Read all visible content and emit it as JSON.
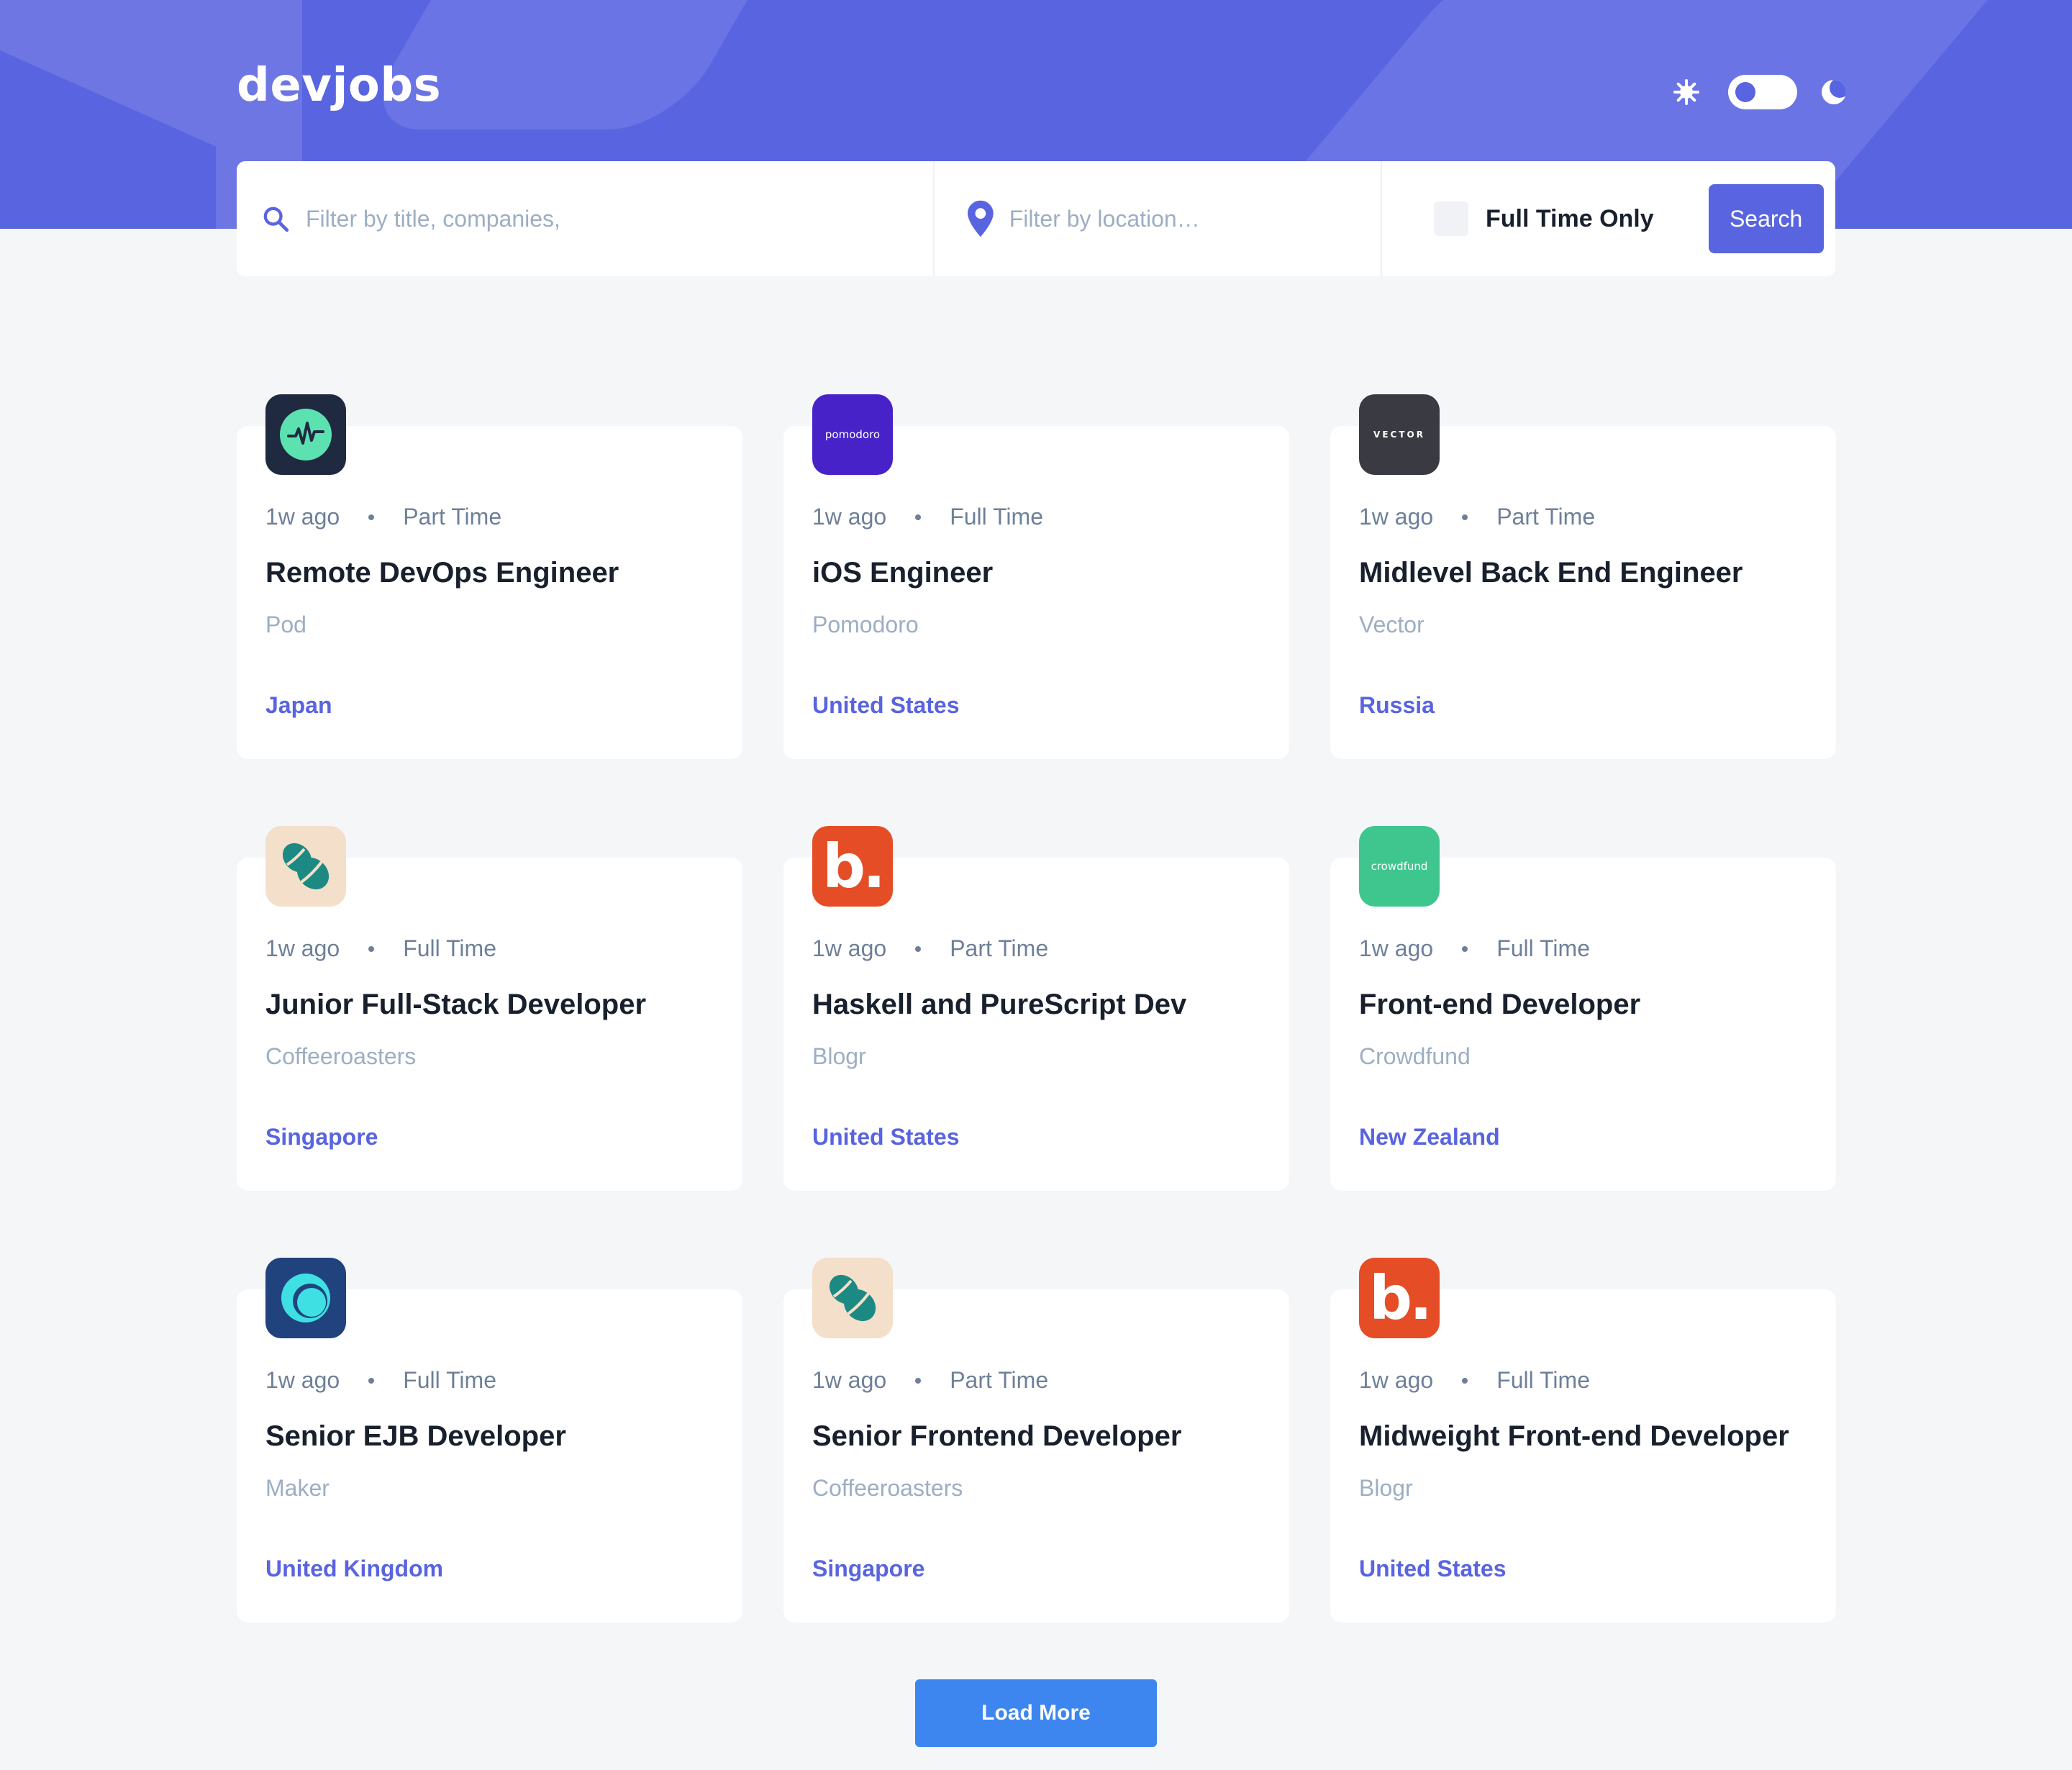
{
  "brand": "devjobs",
  "colors": {
    "accent": "#5964E0",
    "header_bg": "#5964E0",
    "page_bg": "#F4F6F8",
    "load_more": "#3D86F0"
  },
  "theme_toggle": {
    "light_icon": "sun-icon",
    "dark_icon": "moon-icon",
    "mode": "light"
  },
  "search": {
    "title_placeholder": "Filter by title, companies,",
    "title_value": "",
    "location_placeholder": "Filter by location…",
    "location_value": "",
    "full_time_label": "Full Time Only",
    "full_time_checked": false,
    "button_label": "Search"
  },
  "jobs": [
    {
      "posted": "1w ago",
      "contract": "Part Time",
      "title": "Remote DevOps Engineer",
      "company": "Pod",
      "location": "Japan",
      "logo_bg": "#1F2A40",
      "logo_icon": "pod-wave-icon"
    },
    {
      "posted": "1w ago",
      "contract": "Full Time",
      "title": "iOS Engineer",
      "company": "Pomodoro",
      "location": "United States",
      "logo_bg": "#4722C8",
      "logo_text": "pomodoro"
    },
    {
      "posted": "1w ago",
      "contract": "Part Time",
      "title": "Midlevel Back End Engineer",
      "company": "Vector",
      "location": "Russia",
      "logo_bg": "#3A3A42",
      "logo_text": "VECTOR"
    },
    {
      "posted": "1w ago",
      "contract": "Full Time",
      "title": "Junior Full-Stack Developer",
      "company": "Coffeeroasters",
      "location": "Singapore",
      "logo_bg": "#F4DFCB",
      "logo_icon": "coffee-beans-icon"
    },
    {
      "posted": "1w ago",
      "contract": "Part Time",
      "title": "Haskell and PureScript Dev",
      "company": "Blogr",
      "location": "United States",
      "logo_bg": "#E54D26",
      "logo_text": "b."
    },
    {
      "posted": "1w ago",
      "contract": "Full Time",
      "title": "Front-end Developer",
      "company": "Crowdfund",
      "location": "New Zealand",
      "logo_bg": "#3EC68E",
      "logo_text": "crowdfund"
    },
    {
      "posted": "1w ago",
      "contract": "Full Time",
      "title": "Senior EJB Developer",
      "company": "Maker",
      "location": "United Kingdom",
      "logo_bg": "#21437D",
      "logo_icon": "maker-circle-icon"
    },
    {
      "posted": "1w ago",
      "contract": "Part Time",
      "title": "Senior Frontend Developer",
      "company": "Coffeeroasters",
      "location": "Singapore",
      "logo_bg": "#F4DFCB",
      "logo_icon": "coffee-beans-icon"
    },
    {
      "posted": "1w ago",
      "contract": "Full Time",
      "title": "Midweight Front-end Developer",
      "company": "Blogr",
      "location": "United States",
      "logo_bg": "#E54D26",
      "logo_text": "b."
    }
  ],
  "load_more_label": "Load More"
}
